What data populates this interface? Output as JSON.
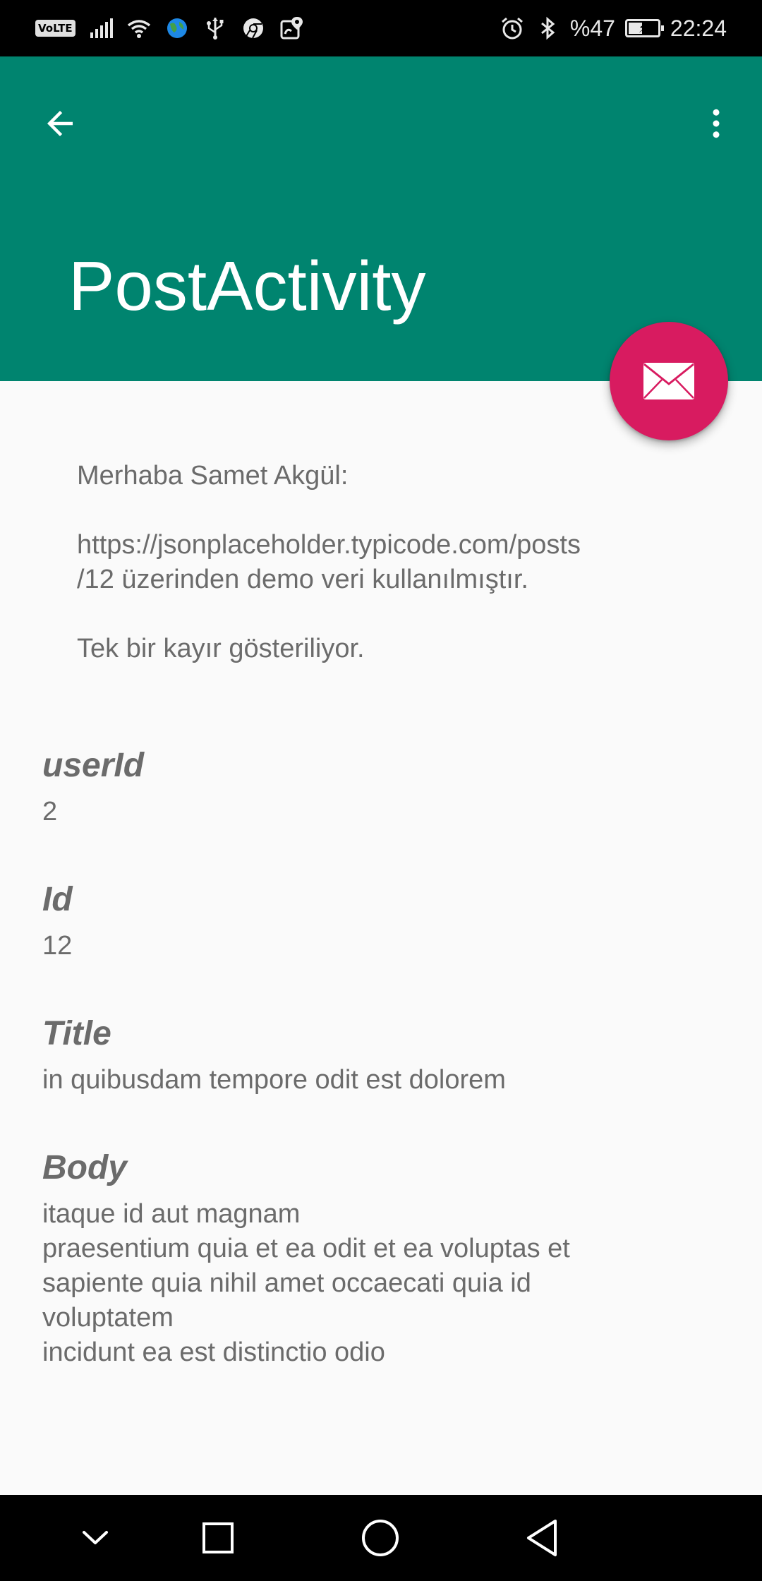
{
  "status_bar": {
    "volte": "VoLTE",
    "battery_text": "%47",
    "battery_level": 0.47,
    "time": "22:24",
    "icons": [
      "signal-icon",
      "wifi-icon",
      "globe-icon",
      "usb-icon",
      "chrome-icon",
      "location-icon",
      "alarm-icon",
      "bluetooth-icon",
      "battery-icon"
    ]
  },
  "app_bar": {
    "title": "PostActivity",
    "background_color": "#00846f",
    "back_icon": "arrow-back-icon",
    "menu_icon": "more-vert-icon"
  },
  "fab": {
    "icon": "mail-icon",
    "color": "#d81b60"
  },
  "intro": {
    "greeting": "Merhaba Samet Akgül:",
    "source_line1": "https://jsonplaceholder.typicode.com/posts",
    "source_line2": "/12 üzerinden demo veri kullanılmıştır.",
    "note": "Tek bir kayır gösteriliyor."
  },
  "post": {
    "userId_label": "userId",
    "userId_value": "2",
    "id_label": "Id",
    "id_value": "12",
    "title_label": "Title",
    "title_value": "in quibusdam tempore odit est dolorem",
    "body_label": "Body",
    "body_lines": [
      "itaque id aut magnam",
      "praesentium quia et ea odit et ea voluptas et",
      "sapiente quia nihil amet occaecati quia id",
      "voluptatem",
      "incidunt ea est distinctio odio"
    ]
  },
  "nav_bar": {
    "buttons": [
      "chevron-down-icon",
      "recents-icon",
      "home-icon",
      "back-icon"
    ]
  }
}
